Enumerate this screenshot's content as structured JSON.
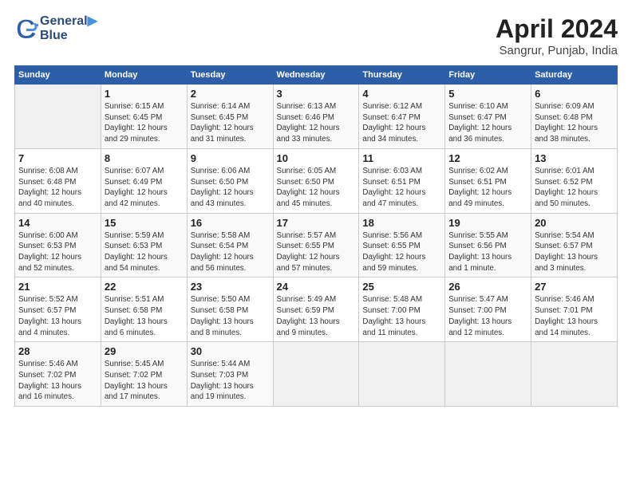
{
  "header": {
    "logo_line1": "General",
    "logo_line2": "Blue",
    "title": "April 2024",
    "subtitle": "Sangrur, Punjab, India"
  },
  "columns": [
    "Sunday",
    "Monday",
    "Tuesday",
    "Wednesday",
    "Thursday",
    "Friday",
    "Saturday"
  ],
  "rows": [
    [
      {
        "day": "",
        "info": ""
      },
      {
        "day": "1",
        "info": "Sunrise: 6:15 AM\nSunset: 6:45 PM\nDaylight: 12 hours\nand 29 minutes."
      },
      {
        "day": "2",
        "info": "Sunrise: 6:14 AM\nSunset: 6:45 PM\nDaylight: 12 hours\nand 31 minutes."
      },
      {
        "day": "3",
        "info": "Sunrise: 6:13 AM\nSunset: 6:46 PM\nDaylight: 12 hours\nand 33 minutes."
      },
      {
        "day": "4",
        "info": "Sunrise: 6:12 AM\nSunset: 6:47 PM\nDaylight: 12 hours\nand 34 minutes."
      },
      {
        "day": "5",
        "info": "Sunrise: 6:10 AM\nSunset: 6:47 PM\nDaylight: 12 hours\nand 36 minutes."
      },
      {
        "day": "6",
        "info": "Sunrise: 6:09 AM\nSunset: 6:48 PM\nDaylight: 12 hours\nand 38 minutes."
      }
    ],
    [
      {
        "day": "7",
        "info": "Sunrise: 6:08 AM\nSunset: 6:48 PM\nDaylight: 12 hours\nand 40 minutes."
      },
      {
        "day": "8",
        "info": "Sunrise: 6:07 AM\nSunset: 6:49 PM\nDaylight: 12 hours\nand 42 minutes."
      },
      {
        "day": "9",
        "info": "Sunrise: 6:06 AM\nSunset: 6:50 PM\nDaylight: 12 hours\nand 43 minutes."
      },
      {
        "day": "10",
        "info": "Sunrise: 6:05 AM\nSunset: 6:50 PM\nDaylight: 12 hours\nand 45 minutes."
      },
      {
        "day": "11",
        "info": "Sunrise: 6:03 AM\nSunset: 6:51 PM\nDaylight: 12 hours\nand 47 minutes."
      },
      {
        "day": "12",
        "info": "Sunrise: 6:02 AM\nSunset: 6:51 PM\nDaylight: 12 hours\nand 49 minutes."
      },
      {
        "day": "13",
        "info": "Sunrise: 6:01 AM\nSunset: 6:52 PM\nDaylight: 12 hours\nand 50 minutes."
      }
    ],
    [
      {
        "day": "14",
        "info": "Sunrise: 6:00 AM\nSunset: 6:53 PM\nDaylight: 12 hours\nand 52 minutes."
      },
      {
        "day": "15",
        "info": "Sunrise: 5:59 AM\nSunset: 6:53 PM\nDaylight: 12 hours\nand 54 minutes."
      },
      {
        "day": "16",
        "info": "Sunrise: 5:58 AM\nSunset: 6:54 PM\nDaylight: 12 hours\nand 56 minutes."
      },
      {
        "day": "17",
        "info": "Sunrise: 5:57 AM\nSunset: 6:55 PM\nDaylight: 12 hours\nand 57 minutes."
      },
      {
        "day": "18",
        "info": "Sunrise: 5:56 AM\nSunset: 6:55 PM\nDaylight: 12 hours\nand 59 minutes."
      },
      {
        "day": "19",
        "info": "Sunrise: 5:55 AM\nSunset: 6:56 PM\nDaylight: 13 hours\nand 1 minute."
      },
      {
        "day": "20",
        "info": "Sunrise: 5:54 AM\nSunset: 6:57 PM\nDaylight: 13 hours\nand 3 minutes."
      }
    ],
    [
      {
        "day": "21",
        "info": "Sunrise: 5:52 AM\nSunset: 6:57 PM\nDaylight: 13 hours\nand 4 minutes."
      },
      {
        "day": "22",
        "info": "Sunrise: 5:51 AM\nSunset: 6:58 PM\nDaylight: 13 hours\nand 6 minutes."
      },
      {
        "day": "23",
        "info": "Sunrise: 5:50 AM\nSunset: 6:58 PM\nDaylight: 13 hours\nand 8 minutes."
      },
      {
        "day": "24",
        "info": "Sunrise: 5:49 AM\nSunset: 6:59 PM\nDaylight: 13 hours\nand 9 minutes."
      },
      {
        "day": "25",
        "info": "Sunrise: 5:48 AM\nSunset: 7:00 PM\nDaylight: 13 hours\nand 11 minutes."
      },
      {
        "day": "26",
        "info": "Sunrise: 5:47 AM\nSunset: 7:00 PM\nDaylight: 13 hours\nand 12 minutes."
      },
      {
        "day": "27",
        "info": "Sunrise: 5:46 AM\nSunset: 7:01 PM\nDaylight: 13 hours\nand 14 minutes."
      }
    ],
    [
      {
        "day": "28",
        "info": "Sunrise: 5:46 AM\nSunset: 7:02 PM\nDaylight: 13 hours\nand 16 minutes."
      },
      {
        "day": "29",
        "info": "Sunrise: 5:45 AM\nSunset: 7:02 PM\nDaylight: 13 hours\nand 17 minutes."
      },
      {
        "day": "30",
        "info": "Sunrise: 5:44 AM\nSunset: 7:03 PM\nDaylight: 13 hours\nand 19 minutes."
      },
      {
        "day": "",
        "info": ""
      },
      {
        "day": "",
        "info": ""
      },
      {
        "day": "",
        "info": ""
      },
      {
        "day": "",
        "info": ""
      }
    ]
  ]
}
